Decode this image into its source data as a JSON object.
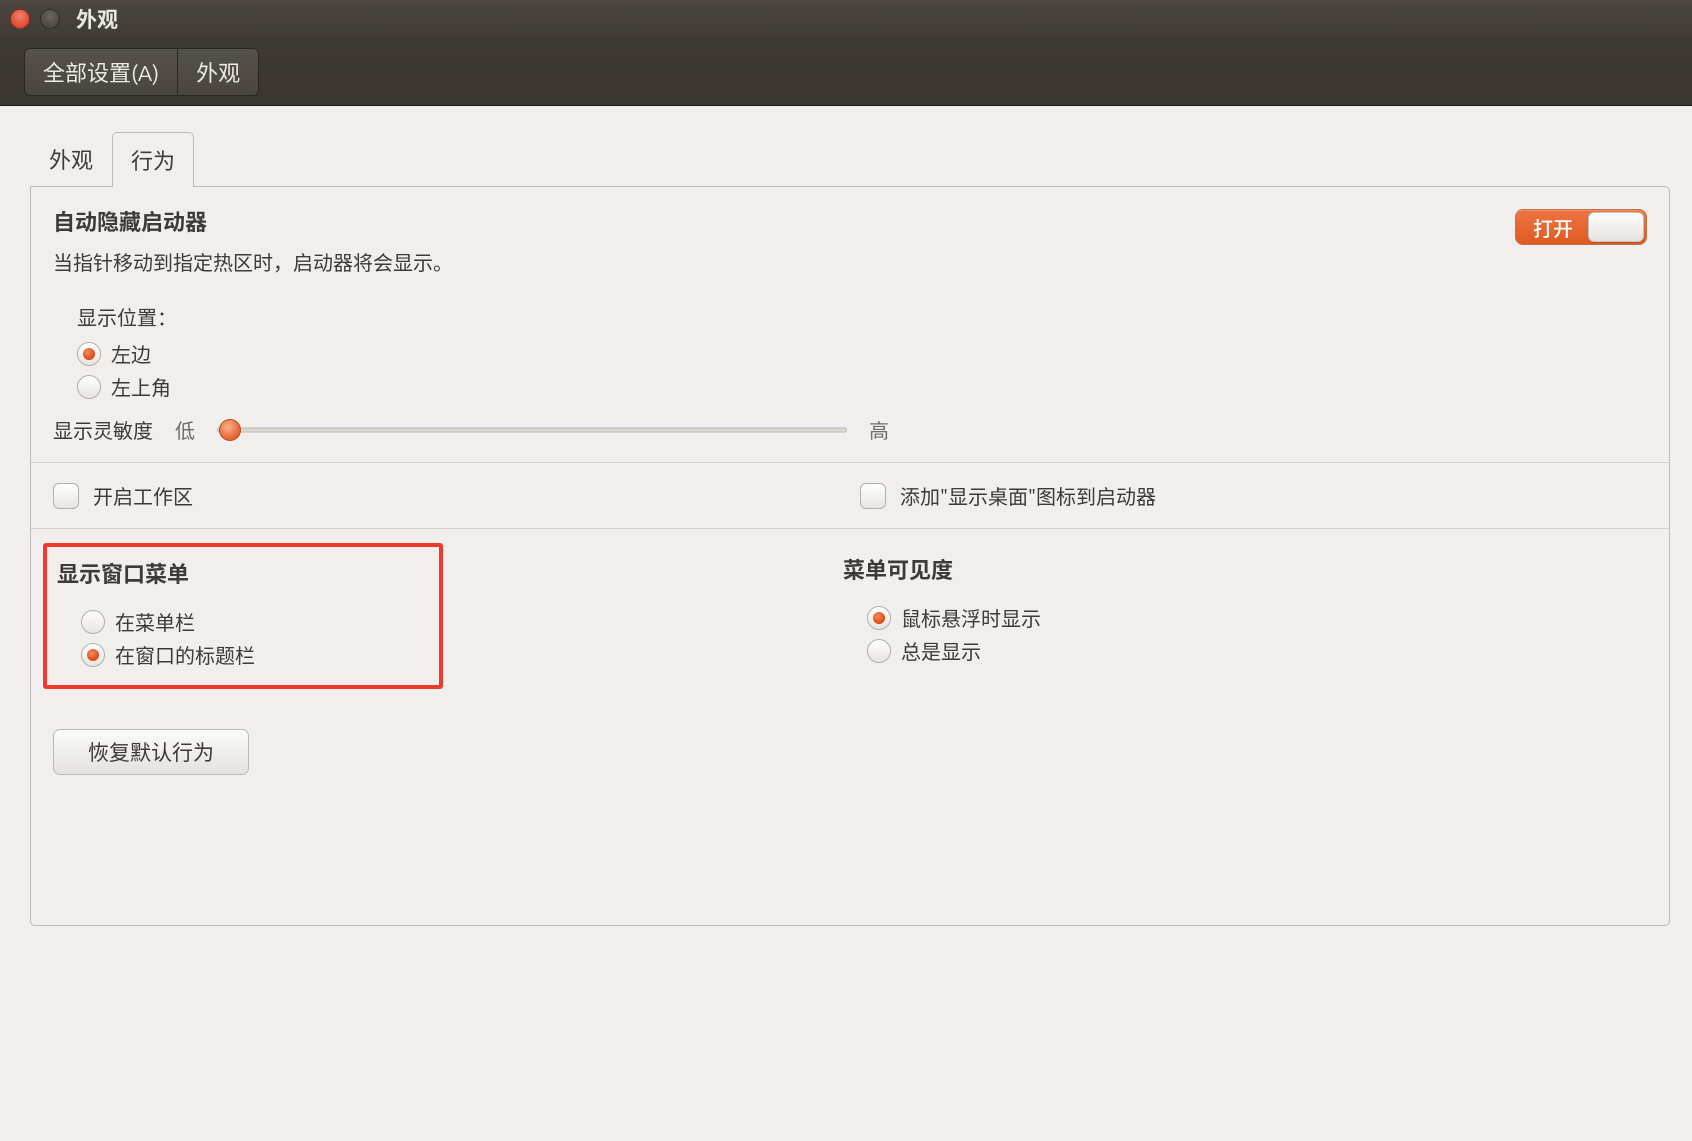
{
  "window": {
    "title": "外观"
  },
  "toolbar": {
    "all_settings_label": "全部设置(A)",
    "appearance_label": "外观"
  },
  "tabs": {
    "appearance": "外观",
    "behavior": "行为"
  },
  "autohide": {
    "heading": "自动隐藏启动器",
    "description": "当指针移动到指定热区时，启动器将会显示。",
    "toggle_label": "打开",
    "toggle_on": true,
    "position_label": "显示位置：",
    "options": {
      "left": "左边",
      "top_left": "左上角"
    },
    "selected": "left",
    "sensitivity_label": "显示灵敏度",
    "sensitivity_low": "低",
    "sensitivity_high": "高",
    "sensitivity_value": 0.02
  },
  "checkboxes": {
    "enable_workspaces": "开启工作区",
    "add_show_desktop": "添加\"显示桌面\"图标到启动器"
  },
  "window_menu": {
    "heading": "显示窗口菜单",
    "options": {
      "in_menubar": "在菜单栏",
      "in_titlebar": "在窗口的标题栏"
    },
    "selected": "in_titlebar"
  },
  "menu_visibility": {
    "heading": "菜单可见度",
    "options": {
      "on_hover": "鼠标悬浮时显示",
      "always": "总是显示"
    },
    "selected": "on_hover"
  },
  "footer": {
    "restore_defaults": "恢复默认行为"
  }
}
